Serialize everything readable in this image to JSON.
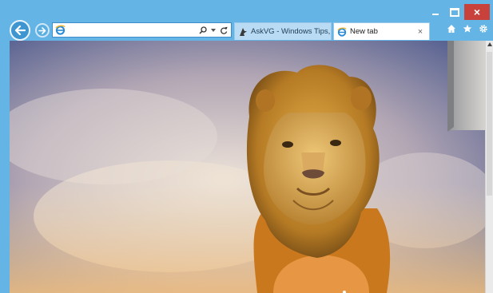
{
  "window": {
    "controls": {
      "minimize": "–",
      "maximize": "□",
      "close": "×"
    }
  },
  "toolbar": {
    "address": {
      "value": "",
      "placeholder": ""
    },
    "back_icon": "arrow-left-icon",
    "forward_icon": "arrow-right-icon",
    "search_icon": "search-icon",
    "dropdown_icon": "chevron-down-icon",
    "refresh_icon": "refresh-icon"
  },
  "tabs": [
    {
      "title": "AskVG - Windows Tips, ...",
      "icon": "askvg-favicon"
    },
    {
      "title": "New tab",
      "icon": "ie-logo-icon",
      "close": "×"
    }
  ],
  "right_tools": {
    "home": "home-icon",
    "favorites": "star-icon",
    "settings": "gear-icon"
  },
  "content": {
    "image": "lion statue against cloudy sky",
    "scrollbar_up": "▲"
  },
  "colors": {
    "frame": "#64b5e6",
    "close_button": "#c8413b",
    "tab_active": "#ffffff",
    "tab_inactive": "#b9dcf4"
  }
}
